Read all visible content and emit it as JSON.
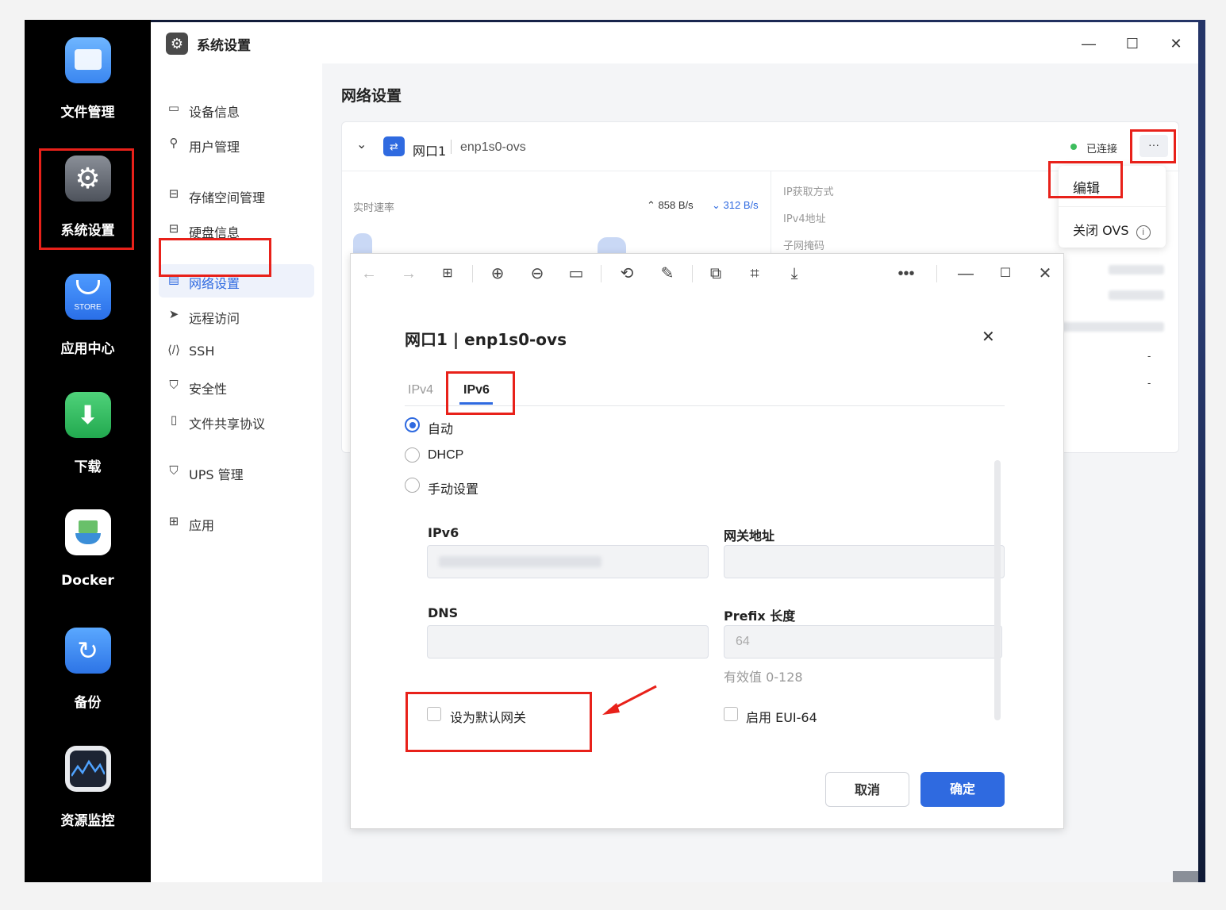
{
  "dock": {
    "items": [
      {
        "label": "文件管理"
      },
      {
        "label": "系统设置"
      },
      {
        "label": "应用中心",
        "badge": "STORE"
      },
      {
        "label": "下载"
      },
      {
        "label": "Docker"
      },
      {
        "label": "备份"
      },
      {
        "label": "资源监控"
      }
    ]
  },
  "window": {
    "title": "系统设置",
    "controls": {
      "minimize": "—",
      "maximize": "☐",
      "close": "✕"
    }
  },
  "sidebar": {
    "items": [
      {
        "label": "设备信息"
      },
      {
        "label": "用户管理"
      },
      {
        "label": "存储空间管理"
      },
      {
        "label": "硬盘信息"
      },
      {
        "label": "网络设置"
      },
      {
        "label": "远程访问"
      },
      {
        "label": "SSH"
      },
      {
        "label": "安全性"
      },
      {
        "label": "文件共享协议"
      },
      {
        "label": "UPS 管理"
      },
      {
        "label": "应用"
      }
    ]
  },
  "main": {
    "title": "网络设置",
    "card": {
      "port_name": "网口1",
      "interface": "enp1s0-ovs",
      "status": "已连接",
      "more": "···",
      "rate_label": "实时速率",
      "upload": "858 B/s",
      "download": "312 B/s",
      "info_labels": [
        "IP获取方式",
        "IPv4地址",
        "子网掩码"
      ],
      "dash_values": [
        "-",
        "-"
      ]
    },
    "menu": {
      "edit": "编辑",
      "close_ovs": "关闭 OVS"
    }
  },
  "dialog": {
    "title": "网口1 | enp1s0-ovs",
    "close": "✕",
    "tabs": [
      "IPv4",
      "IPv6"
    ],
    "radio": [
      "自动",
      "DHCP",
      "手动设置"
    ],
    "ipv6_label": "IPv6",
    "gateway_label": "网关地址",
    "dns_label": "DNS",
    "prefix_label": "Prefix 长度",
    "prefix_value": "64",
    "prefix_hint": "有效值 0-128",
    "default_gateway": "设为默认网关",
    "eui64": "启用 EUI-64",
    "cancel": "取消",
    "confirm": "确定"
  },
  "colors": {
    "accent": "#2f6ae0",
    "annotation": "#e8211a",
    "connected": "#3dbd5d"
  }
}
